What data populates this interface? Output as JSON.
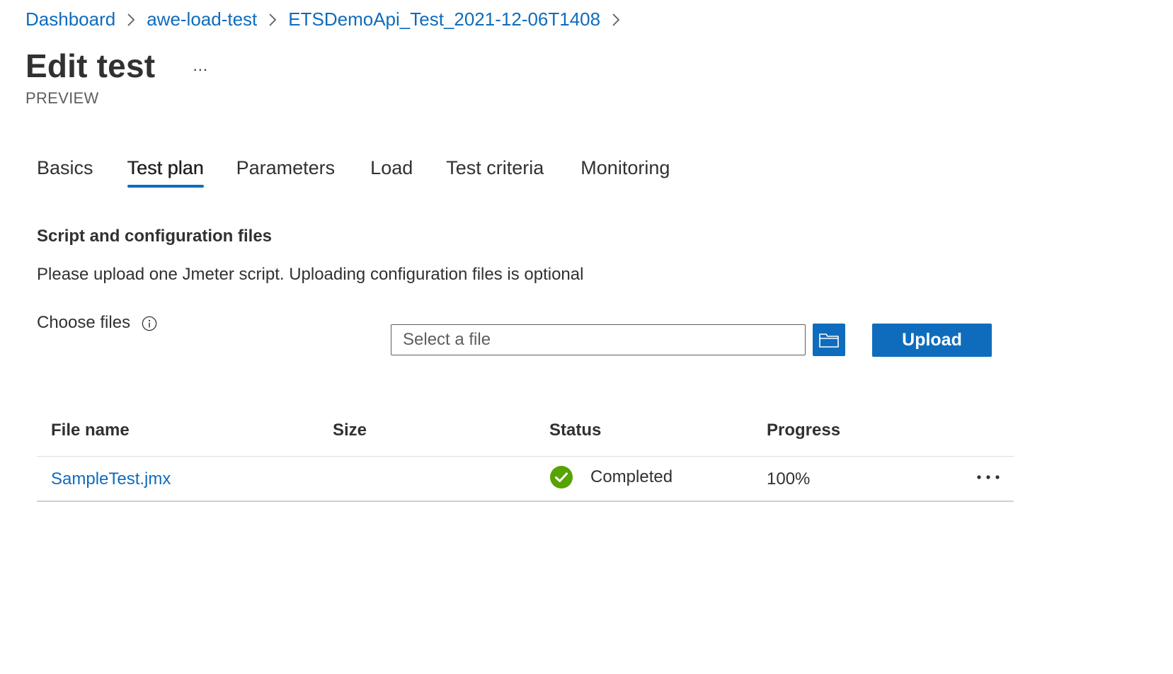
{
  "breadcrumb": {
    "items": [
      {
        "label": "Dashboard"
      },
      {
        "label": "awe-load-test"
      },
      {
        "label": "ETSDemoApi_Test_2021-12-06T1408"
      }
    ]
  },
  "header": {
    "title": "Edit test",
    "more_label": "...",
    "preview_label": "PREVIEW"
  },
  "tabs": [
    {
      "label": "Basics",
      "active": false
    },
    {
      "label": "Test plan",
      "active": true
    },
    {
      "label": "Parameters",
      "active": false
    },
    {
      "label": "Load",
      "active": false
    },
    {
      "label": "Test criteria",
      "active": false
    },
    {
      "label": "Monitoring",
      "active": false
    }
  ],
  "section": {
    "title": "Script and configuration files",
    "description": "Please upload one Jmeter script. Uploading configuration files is optional"
  },
  "choose_files": {
    "label": "Choose files",
    "placeholder": "Select a file",
    "value": "",
    "upload_label": "Upload"
  },
  "table": {
    "columns": [
      "File name",
      "Size",
      "Status",
      "Progress"
    ],
    "rows": [
      {
        "file_name": "SampleTest.jmx",
        "size": "",
        "status": "Completed",
        "progress": "100%",
        "status_icon": "check-circle-icon"
      }
    ]
  },
  "colors": {
    "accent": "#0f6cbd",
    "success": "#57a300",
    "text": "#323130"
  }
}
